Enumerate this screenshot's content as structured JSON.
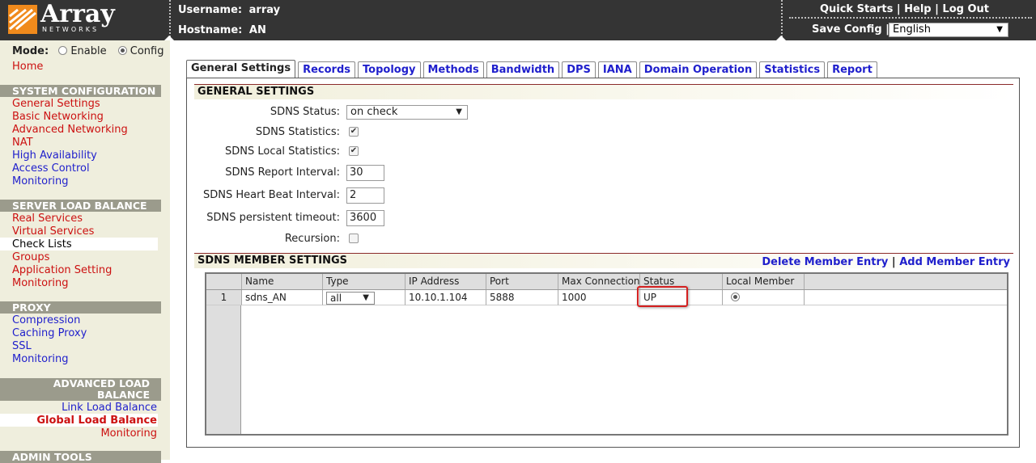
{
  "header": {
    "logo_text": "Array",
    "logo_sub": "NETWORKS",
    "username_label": "Username:",
    "username": "array",
    "hostname_label": "Hostname:",
    "hostname": "AN",
    "links": {
      "quick_starts": "Quick Starts",
      "help": "Help",
      "logout": "Log Out",
      "sep": "|"
    },
    "save_config": "Save Config |",
    "language": "English"
  },
  "sidebar": {
    "mode_label": "Mode:",
    "mode_enable": "Enable",
    "mode_config": "Config",
    "home": "Home",
    "sections": [
      {
        "title": "SYSTEM CONFIGURATION",
        "items": [
          "General Settings",
          "Basic Networking",
          "Advanced Networking",
          "NAT",
          "High Availability",
          "Access Control",
          "Monitoring"
        ]
      },
      {
        "title": "SERVER LOAD BALANCE",
        "items": [
          "Real Services",
          "Virtual Services",
          "Check Lists",
          "Groups",
          "Application Setting",
          "Monitoring"
        ]
      },
      {
        "title": "PROXY",
        "items": [
          "Compression",
          "Caching Proxy",
          "SSL",
          "Monitoring"
        ]
      },
      {
        "title_line1": "ADVANCED LOAD",
        "title_line2": "BALANCE",
        "items": [
          "Link Load Balance",
          "Global Load Balance",
          "Monitoring"
        ]
      },
      {
        "title": "ADMIN TOOLS"
      }
    ]
  },
  "tabs": [
    "General Settings",
    "Records",
    "Topology",
    "Methods",
    "Bandwidth",
    "DPS",
    "IANA",
    "Domain Operation",
    "Statistics",
    "Report"
  ],
  "general": {
    "title": "GENERAL SETTINGS",
    "sdns_status_label": "SDNS Status:",
    "sdns_status_value": "on check",
    "sdns_statistics_label": "SDNS Statistics:",
    "sdns_local_statistics_label": "SDNS Local Statistics:",
    "report_interval_label": "SDNS Report Interval:",
    "report_interval_value": "30",
    "heartbeat_label": "SDNS Heart Beat Interval:",
    "heartbeat_value": "2",
    "persistent_label": "SDNS persistent timeout:",
    "persistent_value": "3600",
    "recursion_label": "Recursion:",
    "sdns_statistics_checked": true,
    "sdns_local_statistics_checked": true,
    "recursion_checked": false
  },
  "member": {
    "title": "SDNS MEMBER SETTINGS",
    "delete_link": "Delete Member Entry",
    "sep": "|",
    "add_link": "Add Member Entry",
    "columns": [
      "Name",
      "Type",
      "IP Address",
      "Port",
      "Max Connections",
      "Status",
      "Local Member"
    ],
    "rows": [
      {
        "num": "1",
        "name": "sdns_AN",
        "type": "all",
        "ip": "10.10.1.104",
        "port": "5888",
        "max_conn": "1000",
        "status": "UP"
      }
    ]
  },
  "colors": {
    "header_bg": "#343434",
    "sidebar_bg": "#efeedd",
    "link_red": "#cc1111",
    "link_blue": "#1f1fcc",
    "highlight_red": "#d42020"
  }
}
